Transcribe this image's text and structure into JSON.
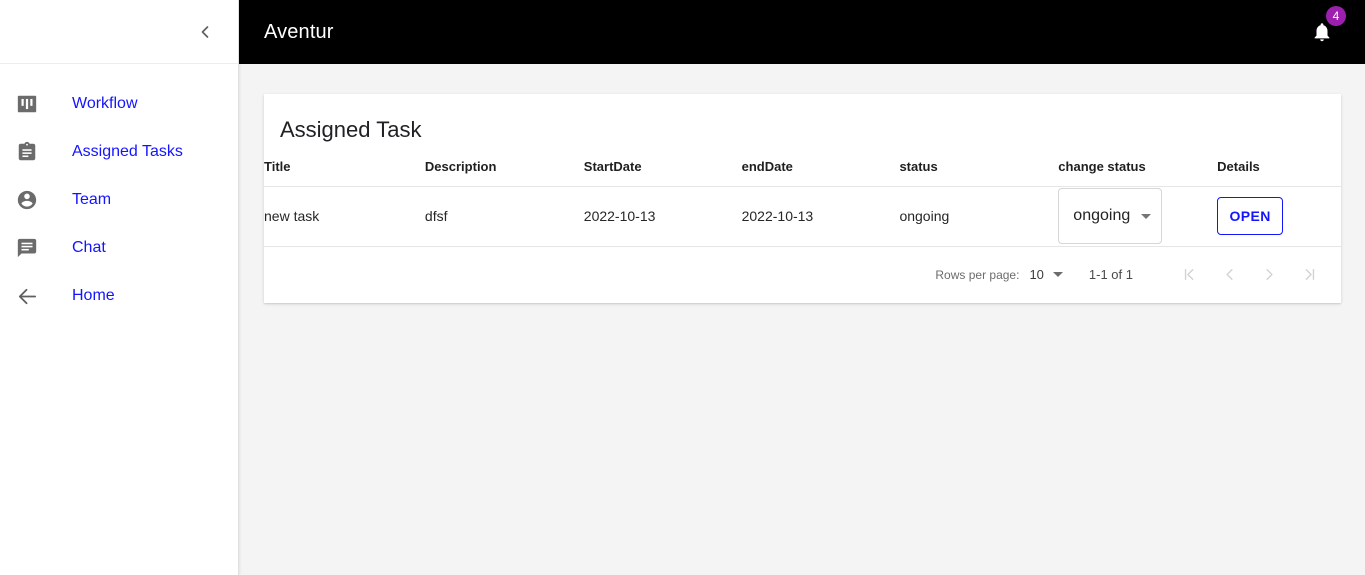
{
  "sidebar": {
    "collapse_button": "chevron-left",
    "items": [
      {
        "label": "Workflow",
        "icon": "dashboard-icon"
      },
      {
        "label": "Assigned Tasks",
        "icon": "assignment-icon"
      },
      {
        "label": "Team",
        "icon": "account-circle-icon"
      },
      {
        "label": "Chat",
        "icon": "chat-icon"
      },
      {
        "label": "Home",
        "icon": "arrow-back-icon"
      }
    ],
    "link_color": "#1414ff"
  },
  "topbar": {
    "title": "Aventur",
    "background": "#000000",
    "notification_icon": "bell-icon",
    "notification_count": "4",
    "badge_color": "#9c1fae"
  },
  "card": {
    "title": "Assigned Task",
    "table": {
      "headers": [
        "Title",
        "Description",
        "StartDate",
        "endDate",
        "status",
        "change status",
        "Details"
      ],
      "rows": [
        {
          "title": "new task",
          "description": "dfsf",
          "start_date": "2022-10-13",
          "end_date": "2022-10-13",
          "status": "ongoing",
          "change_status_value": "ongoing",
          "details_button": "OPEN"
        }
      ]
    },
    "pagination": {
      "rows_per_page_label": "Rows per page:",
      "rows_per_page_value": "10",
      "range": "1-1 of 1",
      "first_page": "first-page-icon",
      "prev_page": "previous-page-icon",
      "next_page": "next-page-icon",
      "last_page": "last-page-icon"
    }
  }
}
